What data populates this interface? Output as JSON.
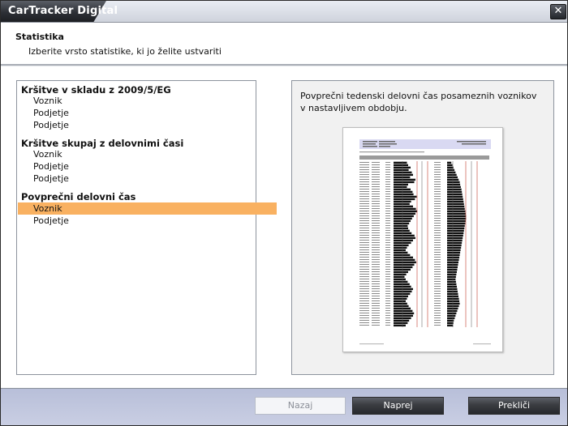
{
  "window": {
    "title": "CarTracker Digital"
  },
  "header": {
    "title": "Statistika",
    "subtitle": "Izberite vrsto statistike, ki jo želite ustvariti"
  },
  "groups": [
    {
      "title": "Kršitve v skladu z 2009/5/EG",
      "items": [
        "Voznik",
        "Podjetje",
        "Podjetje"
      ]
    },
    {
      "title": "Kršitve skupaj z delovnimi časi",
      "items": [
        "Voznik",
        "Podjetje",
        "Podjetje"
      ]
    },
    {
      "title": "Povprečni delovni čas",
      "items": [
        "Voznik",
        "Podjetje"
      ]
    }
  ],
  "selected": {
    "group": 2,
    "item": 0
  },
  "preview": {
    "description": "Povprečni tedenski delovni čas posameznih voznikov v nastavljivem obdobju.",
    "bar_fill_left": [
      0.55,
      0.6,
      0.7,
      0.62,
      0.75,
      0.8,
      0.68,
      0.9,
      0.85,
      0.6,
      0.55,
      0.7,
      0.78,
      0.82,
      0.95,
      0.88,
      0.72,
      0.66,
      0.8,
      0.92,
      0.97,
      0.9,
      0.83,
      0.76,
      0.7,
      0.64,
      0.58,
      0.6,
      0.66,
      0.74,
      0.86,
      0.9,
      0.8,
      0.72,
      0.62,
      0.55,
      0.5,
      0.58,
      0.68,
      0.8,
      0.88,
      0.93,
      0.85,
      0.78,
      0.7,
      0.6,
      0.52,
      0.45,
      0.5,
      0.58,
      0.66,
      0.72,
      0.8,
      0.75,
      0.68,
      0.6,
      0.55,
      0.5,
      0.56,
      0.62,
      0.7,
      0.78,
      0.84,
      0.8,
      0.72,
      0.64,
      0.58,
      0.5
    ],
    "bar_fill_right": [
      0.2,
      0.25,
      0.3,
      0.35,
      0.4,
      0.45,
      0.5,
      0.55,
      0.6,
      0.62,
      0.65,
      0.68,
      0.7,
      0.72,
      0.74,
      0.76,
      0.78,
      0.8,
      0.82,
      0.84,
      0.86,
      0.88,
      0.9,
      0.9,
      0.88,
      0.86,
      0.84,
      0.82,
      0.8,
      0.78,
      0.76,
      0.74,
      0.72,
      0.7,
      0.68,
      0.66,
      0.64,
      0.62,
      0.6,
      0.58,
      0.56,
      0.54,
      0.52,
      0.5,
      0.48,
      0.46,
      0.44,
      0.42,
      0.4,
      0.42,
      0.44,
      0.46,
      0.48,
      0.5,
      0.52,
      0.54,
      0.56,
      0.58,
      0.6,
      0.56,
      0.52,
      0.48,
      0.44,
      0.4,
      0.36,
      0.32,
      0.3,
      0.28
    ]
  },
  "buttons": {
    "back": "Nazaj",
    "next": "Naprej",
    "cancel": "Prekliči"
  }
}
